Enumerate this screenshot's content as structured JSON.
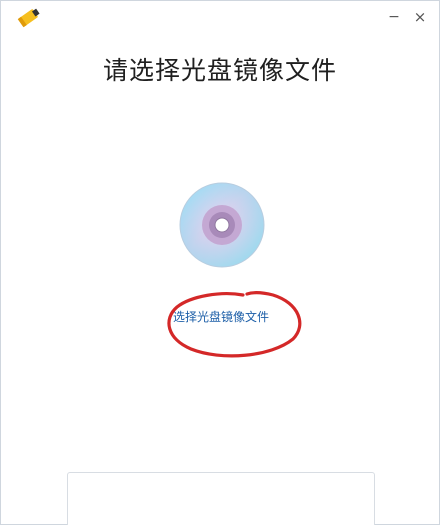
{
  "window": {
    "app_icon": "usb-drive-icon",
    "minimize_label": "−",
    "close_label": "×"
  },
  "main": {
    "title": "请选择光盘镜像文件",
    "disc_icon": "disc-icon",
    "select_link": "选择光盘镜像文件"
  },
  "annotation": {
    "mark": "red-handdrawn-circle",
    "color": "#d42828"
  },
  "footer": {
    "box_value": ""
  }
}
